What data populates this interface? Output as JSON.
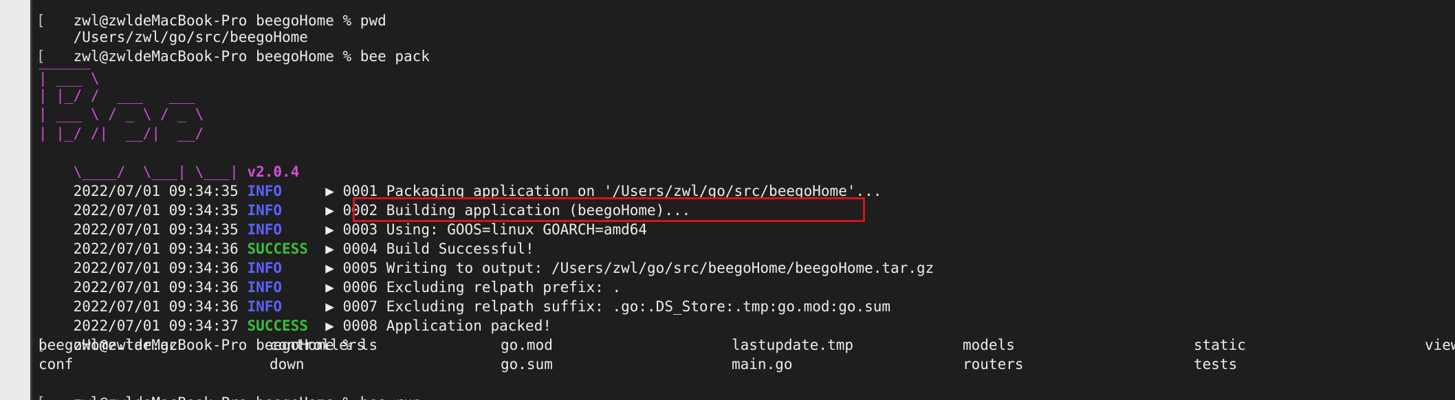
{
  "terminal": {
    "lines": [
      {
        "kind": "prompt",
        "text": "zwl@zwldeMacBook-Pro beegoHome % pwd"
      },
      {
        "kind": "plain",
        "text": "/Users/zwl/go/src/beegoHome"
      },
      {
        "kind": "prompt",
        "text": "zwl@zwldeMacBook-Pro beegoHome % bee pack"
      },
      {
        "kind": "blank",
        "text": ""
      }
    ],
    "ascii_logo": [
      "______",
      "| ___ \\",
      "| |_/ /  ___   ___",
      "| ___ \\ / _ \\ / _ \\",
      "| |_/ /|  __/|  __/",
      "\\____/  \\___| \\___|"
    ],
    "version": "v2.0.4",
    "log": [
      {
        "ts": "2022/07/01 09:34:35",
        "level": "INFO",
        "msg": "▶ 0001 Packaging application on '/Users/zwl/go/src/beegoHome'..."
      },
      {
        "ts": "2022/07/01 09:34:35",
        "level": "INFO",
        "msg": "▶ 0002 Building application (beegoHome)..."
      },
      {
        "ts": "2022/07/01 09:34:35",
        "level": "INFO",
        "msg": "▶ 0003 Using: GOOS=linux GOARCH=amd64"
      },
      {
        "ts": "2022/07/01 09:34:36",
        "level": "SUCCESS",
        "msg": "▶ 0004 Build Successful!"
      },
      {
        "ts": "2022/07/01 09:34:36",
        "level": "INFO",
        "msg": "▶ 0005 Writing to output: /Users/zwl/go/src/beegoHome/beegoHome.tar.gz"
      },
      {
        "ts": "2022/07/01 09:34:36",
        "level": "INFO",
        "msg": "▶ 0006 Excluding relpath prefix: ."
      },
      {
        "ts": "2022/07/01 09:34:36",
        "level": "INFO",
        "msg": "▶ 0007 Excluding relpath suffix: .go:.DS_Store:.tmp:go.mod:go.sum"
      },
      {
        "ts": "2022/07/01 09:34:37",
        "level": "SUCCESS",
        "msg": "▶ 0008 Application packed!"
      }
    ],
    "ls_prompt": "zwl@zwldeMacBook-Pro beegoHome % ls",
    "ls_rows": [
      [
        "beegoHome.tar.gz",
        "controllers",
        "go.mod",
        "lastupdate.tmp",
        "models",
        "static",
        "views"
      ],
      [
        "conf",
        "down",
        "go.sum",
        "main.go",
        "routers",
        "tests",
        ""
      ]
    ],
    "final_prompt": "zwl@zwldeMacBook-Pro beegoHome % bee run",
    "colors": {
      "background": "#1e1e1e",
      "foreground": "#ededed",
      "logo": "#d24fd9",
      "info": "#5b62ff",
      "success": "#39c03a",
      "highlight": "#d8141c"
    }
  }
}
